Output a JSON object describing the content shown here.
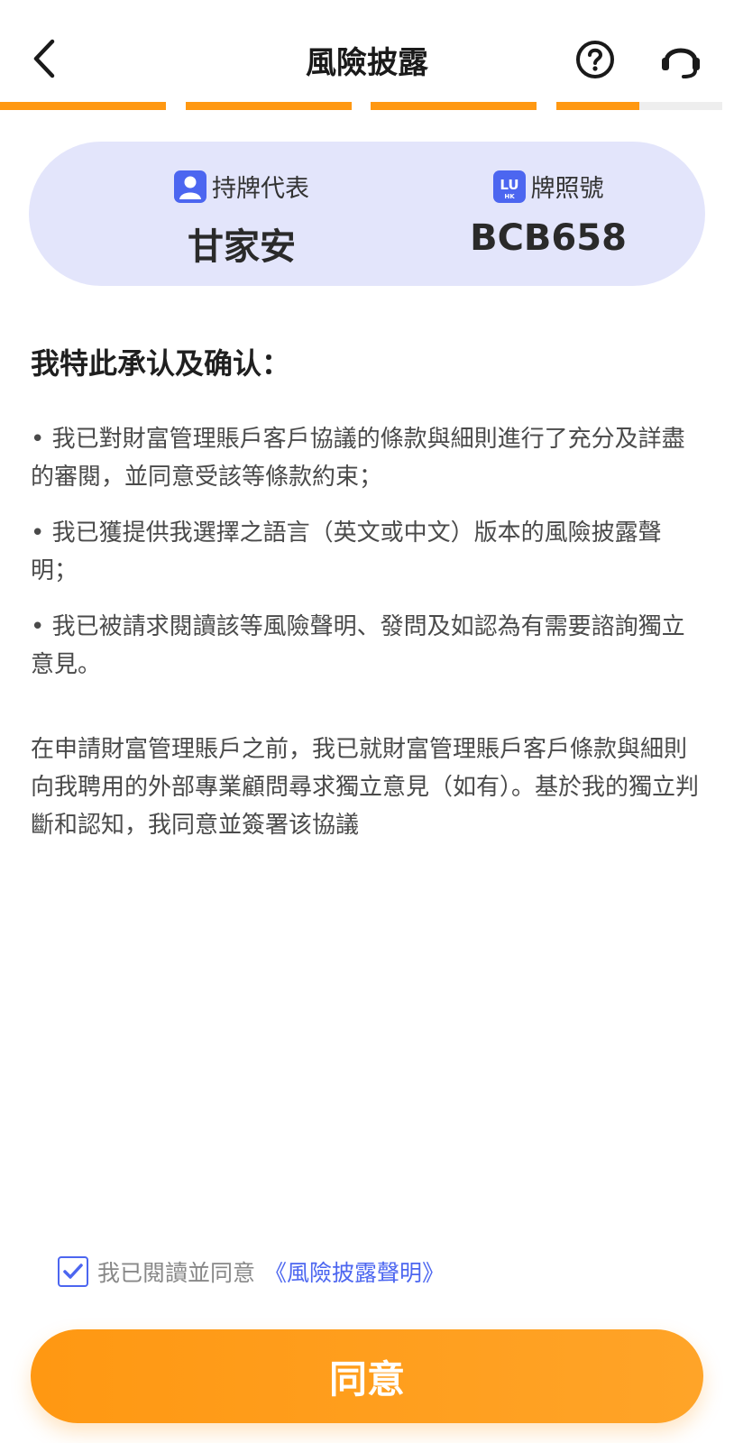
{
  "header": {
    "title": "風險披露",
    "back_icon": "chevron-left-icon",
    "help_icon": "question-circle-icon",
    "support_icon": "headset-icon"
  },
  "progress": {
    "total_steps": 4,
    "completed_steps": 3,
    "current_step_fraction": 0.5,
    "active_color": "#ff9812",
    "inactive_color": "#eeeeee"
  },
  "agent": {
    "rep_label": "持牌代表",
    "rep_name": "甘家安",
    "license_label": "牌照號",
    "license_no": "BCB658",
    "card_color": "#e3e5fb",
    "icon_color": "#4c66f0",
    "logo_text": "LU",
    "logo_sub": "HK"
  },
  "content": {
    "heading": "我特此承认及确认：",
    "bullets": [
      "• 我已對財富管理賬戶客戶協議的條款與細則進行了充分及詳盡的審閱，並同意受該等條款約束；",
      "• 我已獲提供我選擇之語言（英文或中文）版本的風險披露聲明；",
      "• 我已被請求閱讀該等風險聲明、發問及如認為有需要諮詢獨立意見。"
    ],
    "paragraph": "在申請財富管理賬戶之前，我已就財富管理賬戶客戶條款與細則向我聘用的外部專業顧問尋求獨立意見（如有）。基於我的獨立判斷和認知，我同意並簽署该協議"
  },
  "agreement": {
    "checked": true,
    "text": "我已閱讀並同意",
    "link": "《風險披露聲明》"
  },
  "button": {
    "label": "同意"
  }
}
